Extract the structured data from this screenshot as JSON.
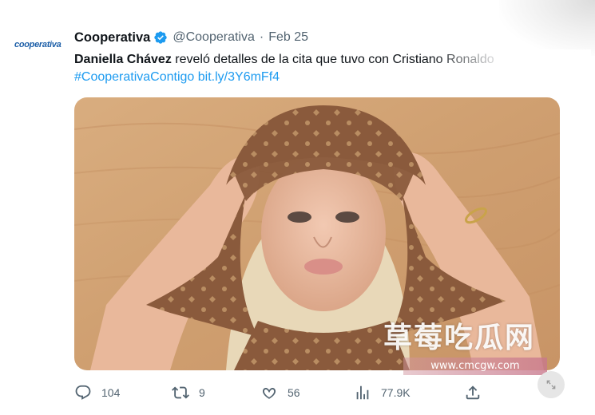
{
  "account": {
    "avatar_text": "cooperativa",
    "name": "Cooperativa",
    "handle": "@Cooperativa",
    "separator": "·",
    "date": "Feb 25",
    "verified": true
  },
  "tweet": {
    "bold_name": "Daniella Chávez",
    "text": " reveló detalles de la cita que tuvo con Cristiano Ronaldo",
    "hashtag": "#CooperativaContigo",
    "link": "bit.ly/3Y6mFf4"
  },
  "media": {
    "description_icon": "photo"
  },
  "watermark": {
    "text": "草莓吃瓜网",
    "url": "www.cmcgw.com"
  },
  "actions": {
    "replies": "104",
    "retweets": "9",
    "likes": "56",
    "views": "77.9K"
  },
  "colors": {
    "link": "#1d9bf0",
    "secondary_text": "#536471",
    "brand": "#1d5fa8"
  }
}
